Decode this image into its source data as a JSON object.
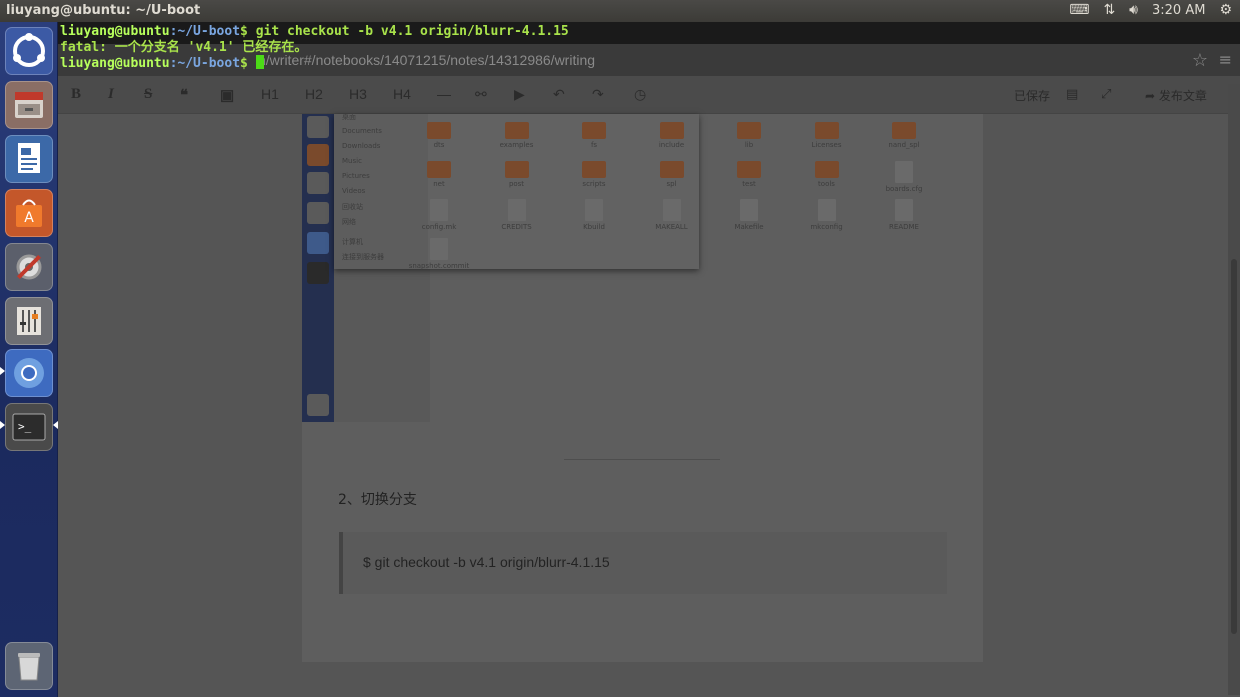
{
  "window": {
    "title": "liuyang@ubuntu: ~/U-boot"
  },
  "panel": {
    "time": "3:20 AM"
  },
  "launcher": {
    "items": [
      "ubuntu-dash",
      "files",
      "libreoffice-writer",
      "software-center",
      "system-settings",
      "mixer",
      "chromium",
      "terminal",
      "trash"
    ]
  },
  "terminal": {
    "line1_prompt_user": "liuyang@ubuntu",
    "line1_prompt_path": ":~/U-boot",
    "line1_prompt_sym": "$ ",
    "line1_cmd": "git checkout -b v4.1 origin/blurr-4.1.15",
    "line2": "fatal: 一个分支名 'v4.1' 已经存在。",
    "line3_prompt_user": "liuyang@ubuntu",
    "line3_prompt_path": ":~/U-boot",
    "line3_prompt_sym": "$ "
  },
  "browser": {
    "url": "n/writer#/notebooks/14071215/notes/14312986/writing"
  },
  "toolbar": {
    "bold": "B",
    "italic": "I",
    "strike": "S",
    "quote": "❝",
    "image": "▣",
    "h1": "H1",
    "h2": "H2",
    "h3": "H3",
    "h4": "H4",
    "hr": "—",
    "link": "⚯",
    "video": "▶",
    "undo": "↶",
    "redo": "↷",
    "clock": "◷",
    "saved": "已保存",
    "publish": "发布文章"
  },
  "embed": {
    "sidebar": [
      "桌面",
      "Documents",
      "Downloads",
      "Music",
      "Pictures",
      "Videos",
      "回收站",
      "网络",
      "计算机",
      "连接到服务器"
    ],
    "files_row1": [
      "dts",
      "examples",
      "fs",
      "include",
      "lib",
      "Licenses",
      "nand_spl"
    ],
    "files_row2": [
      "net",
      "post",
      "scripts",
      "spl",
      "test",
      "tools",
      "boards.cfg"
    ],
    "files_row3": [
      "config.mk",
      "CREDITS",
      "Kbuild",
      "MAKEALL",
      "Makefile",
      "mkconfig",
      "README"
    ],
    "files_row4": [
      "snapshot.commit"
    ]
  },
  "doc": {
    "section_title": "2、切换分支",
    "code": "$ git checkout -b v4.1 origin/blurr-4.1.15"
  }
}
